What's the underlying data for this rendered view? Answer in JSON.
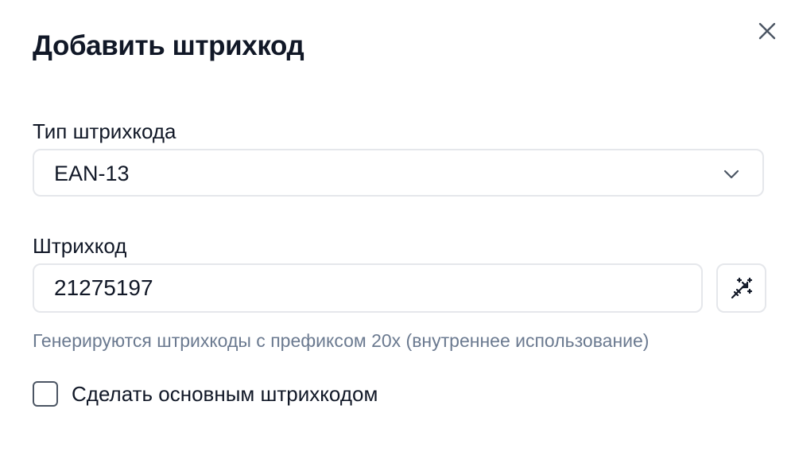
{
  "dialog": {
    "title": "Добавить штрихкод",
    "close_icon": "close-icon"
  },
  "barcode_type": {
    "label": "Тип штрихкода",
    "value": "EAN-13",
    "icon": "chevron-down-icon"
  },
  "barcode": {
    "label": "Штрихкод",
    "value": "21275197",
    "generate_icon": "magic-wand-icon",
    "hint": "Генерируются штрихкоды с префиксом 20x (внутреннее использование)"
  },
  "primary_checkbox": {
    "label": "Сделать основным штрихкодом",
    "checked": false
  },
  "colors": {
    "text": "#111827",
    "hint": "#6b7a90",
    "border": "#e5e7eb"
  }
}
